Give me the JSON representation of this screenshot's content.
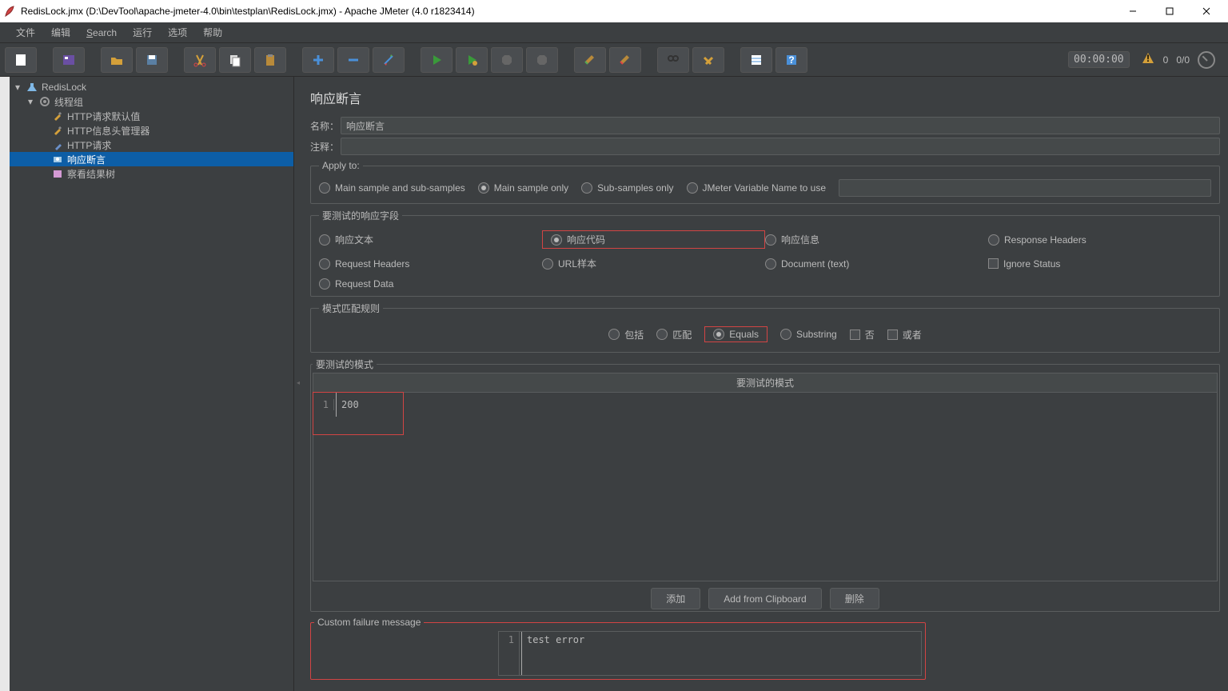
{
  "window": {
    "title": "RedisLock.jmx (D:\\DevTool\\apache-jmeter-4.0\\bin\\testplan\\RedisLock.jmx) - Apache JMeter (4.0 r1823414)"
  },
  "menu": {
    "file": "文件",
    "edit": "编辑",
    "search": "Search",
    "run": "运行",
    "options": "选项",
    "help": "帮助"
  },
  "toolbar": {
    "timer": "00:00:00",
    "warn_count": "0",
    "thread_ratio": "0/0"
  },
  "tree": {
    "root": "RedisLock",
    "thread_group": "线程组",
    "http_defaults": "HTTP请求默认值",
    "http_header_mgr": "HTTP信息头管理器",
    "http_request": "HTTP请求",
    "response_assertion": "响应断言",
    "view_results_tree": "察看结果树"
  },
  "panel": {
    "title": "响应断言",
    "name_label": "名称：",
    "name_value": "响应断言",
    "comment_label": "注释：",
    "comment_value": ""
  },
  "apply_to": {
    "legend": "Apply to:",
    "opt1": "Main sample and sub-samples",
    "opt2": "Main sample only",
    "opt3": "Sub-samples only",
    "opt4": "JMeter Variable Name to use"
  },
  "test_field": {
    "legend": "要测试的响应字段",
    "response_text": "响应文本",
    "response_code": "响应代码",
    "response_message": "响应信息",
    "response_headers": "Response Headers",
    "request_headers": "Request Headers",
    "url_sampled": "URL样本",
    "document_text": "Document (text)",
    "ignore_status": "Ignore Status",
    "request_data": "Request Data"
  },
  "match_rule": {
    "legend": "模式匹配规则",
    "contains": "包括",
    "matches": "匹配",
    "equals": "Equals",
    "substring": "Substring",
    "not": "否",
    "or": "或者"
  },
  "patterns": {
    "legend": "要测试的模式",
    "header": "要测试的模式",
    "rows": [
      "200"
    ]
  },
  "buttons": {
    "add": "添加",
    "from_clipboard": "Add from Clipboard",
    "delete": "删除"
  },
  "custom_msg": {
    "legend": "Custom failure message",
    "value": "test error"
  }
}
